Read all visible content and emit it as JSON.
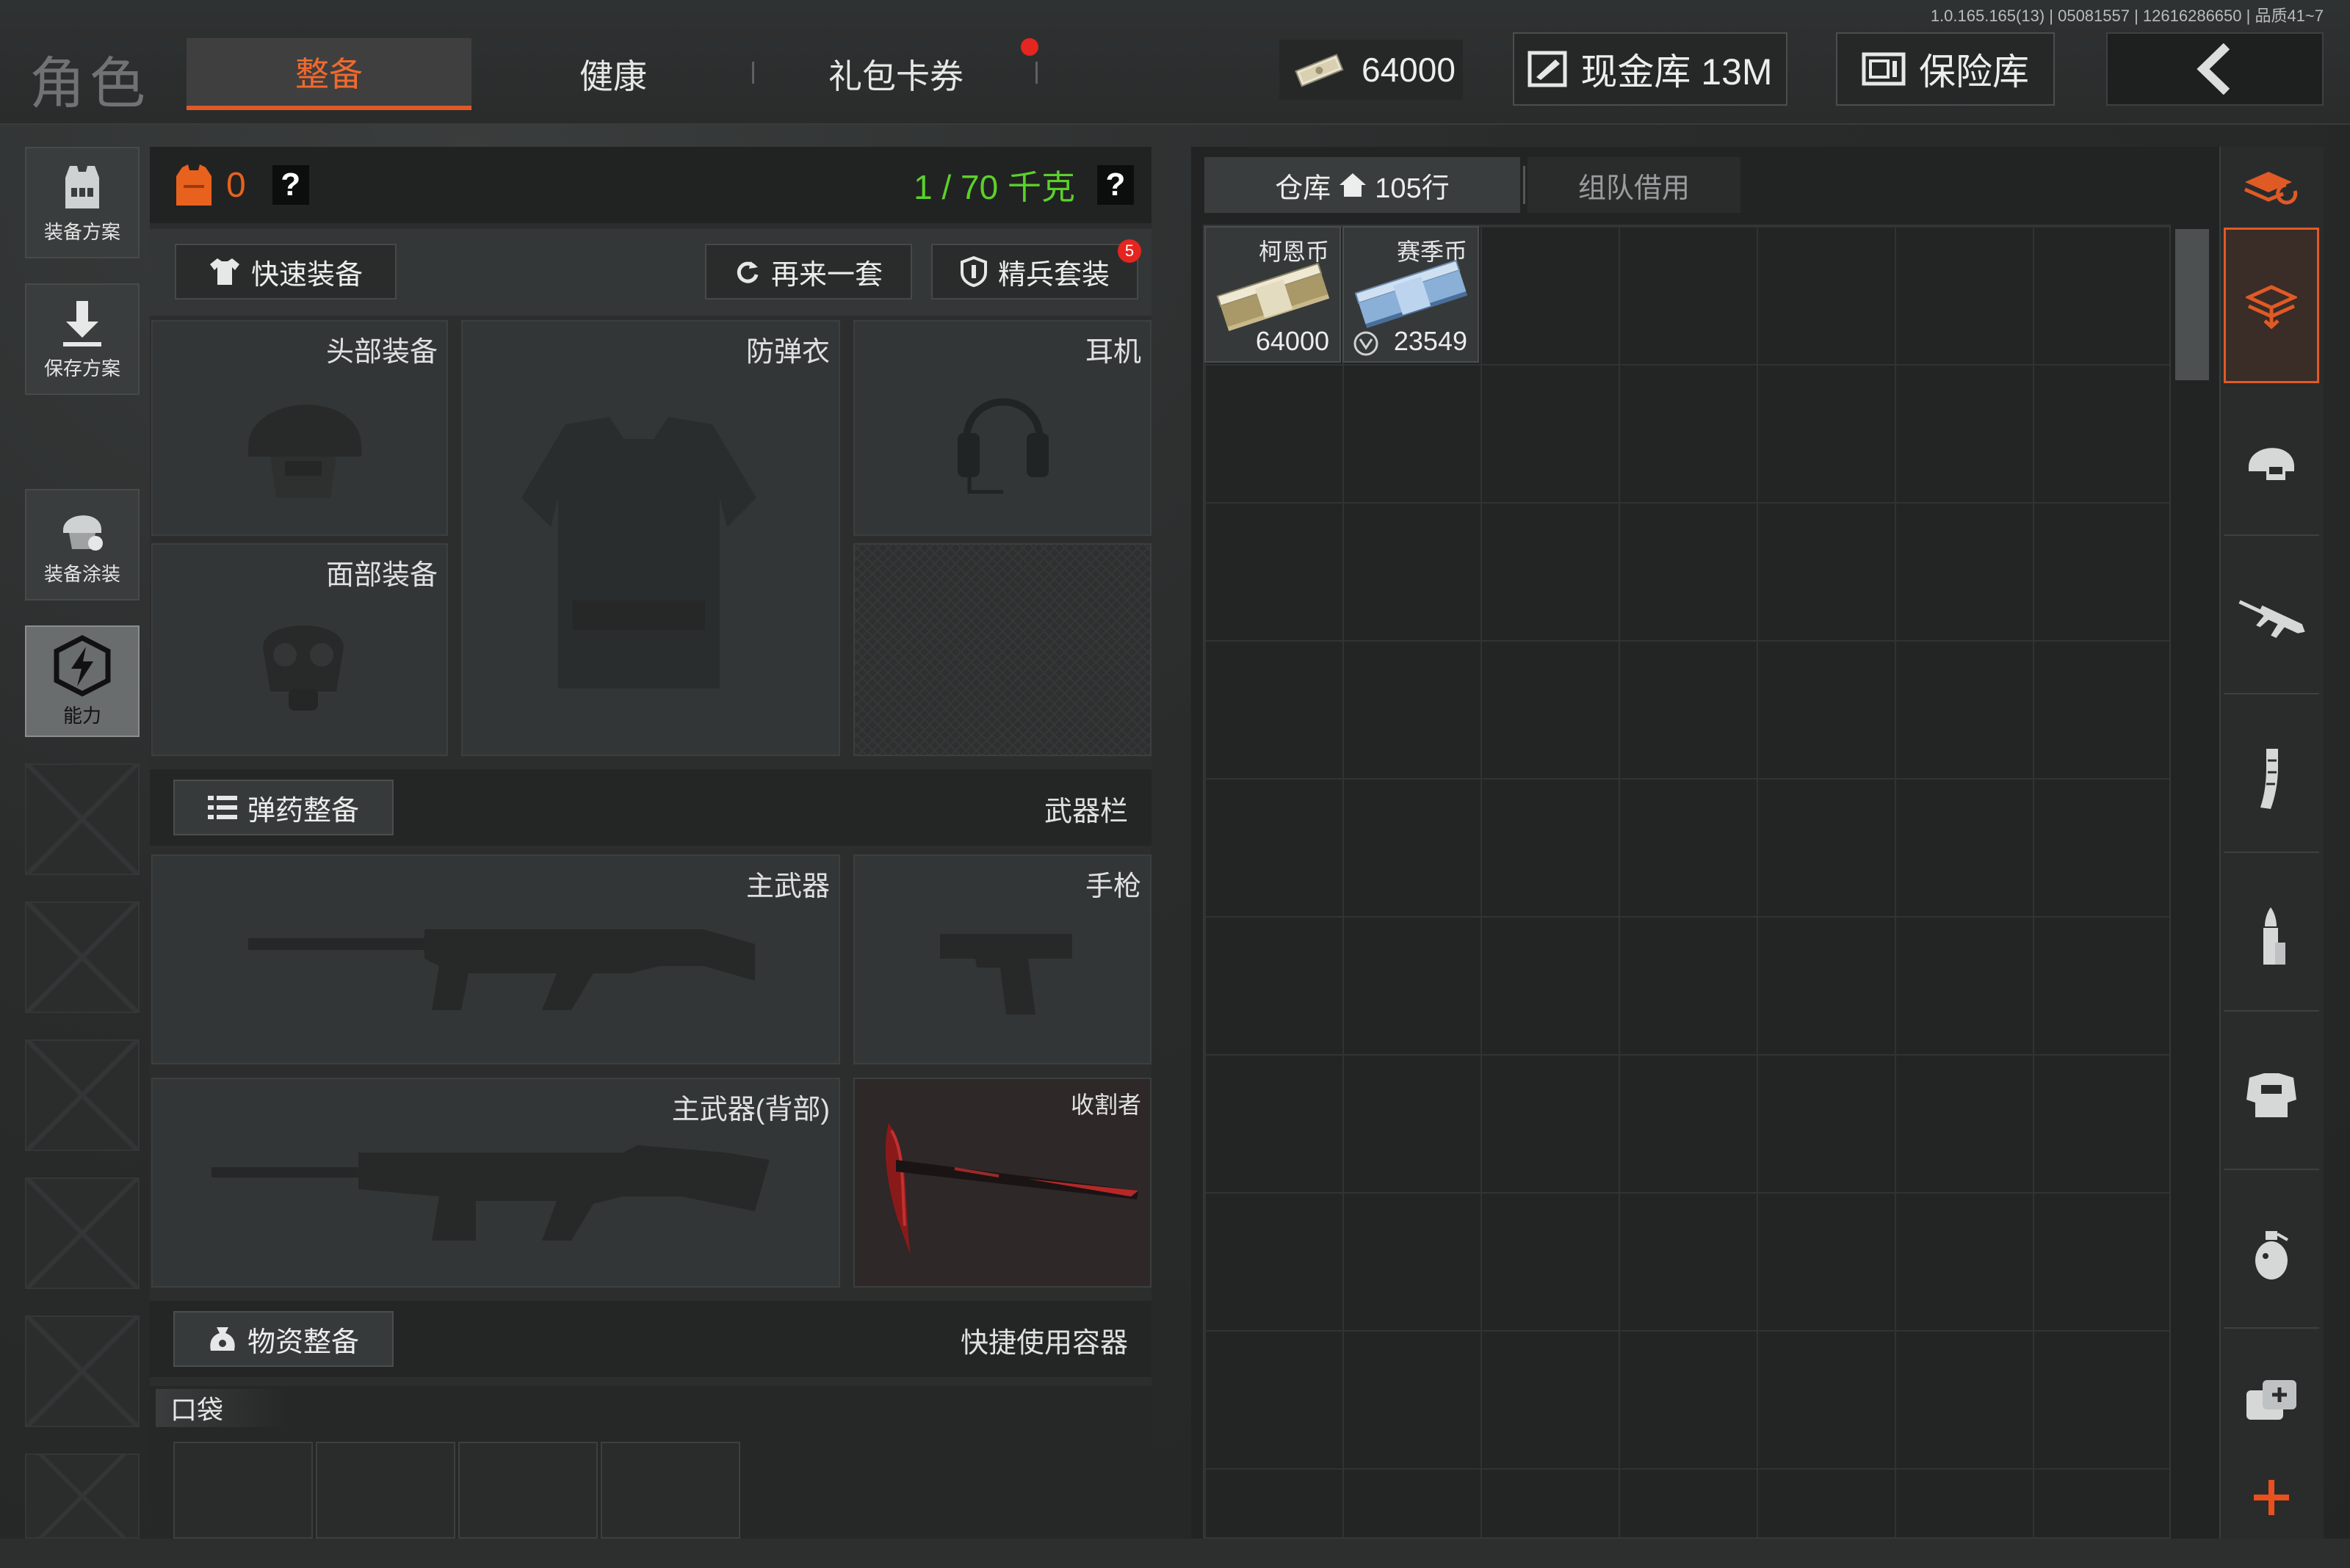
{
  "app": {
    "version": "1.0.165.165(13) | 05081557 | 12616286650 | 品质41~7",
    "section_title": "角色"
  },
  "tabs": [
    {
      "label": "整备",
      "active": true
    },
    {
      "label": "健康",
      "active": false
    },
    {
      "label": "礼包卡券",
      "active": false
    }
  ],
  "header": {
    "money": "64000",
    "cash_vault": "现金库 13M",
    "safe": "保险库"
  },
  "sidebar": {
    "items": [
      {
        "label": "装备方案",
        "icon": "vest-icon"
      },
      {
        "label": "保存方案",
        "icon": "download-icon"
      },
      {
        "label": "装备涂装",
        "icon": "helmet-paint-icon"
      },
      {
        "label": "能力",
        "icon": "ability-icon"
      }
    ]
  },
  "loadout": {
    "count": "0",
    "weight": "1 / 70 千克",
    "quick_equip": "快速装备",
    "repeat": "再来一套",
    "elite": "精兵套装",
    "elite_badge": "5",
    "slots": {
      "head": "头部装备",
      "armor": "防弹衣",
      "headset": "耳机",
      "face": "面部装备"
    },
    "ammo_section": "弹药整备",
    "weapon_bar": "武器栏",
    "weapons": {
      "primary": "主武器",
      "pistol": "手枪",
      "primary_back": "主武器(背部)",
      "melee": "收割者"
    },
    "supply_section": "物资整备",
    "quick_container": "快捷使用容器",
    "pocket": "口袋"
  },
  "storage": {
    "tab_label": "仓库",
    "tab_rows": "105行",
    "team_tab": "组队借用",
    "items": [
      {
        "name": "柯恩币",
        "qty": "64000"
      },
      {
        "name": "赛季币",
        "qty": "23549"
      }
    ]
  },
  "categories": [
    "all-icon",
    "stack-icon",
    "helmet-icon",
    "rifle-icon",
    "magazine-icon",
    "bullet-icon",
    "armor-icon",
    "grenade-icon",
    "medkit-icon",
    "add-icon"
  ],
  "colors": {
    "accent": "#e05a25",
    "weight_green": "#5bd12a",
    "badge_red": "#e52520"
  }
}
